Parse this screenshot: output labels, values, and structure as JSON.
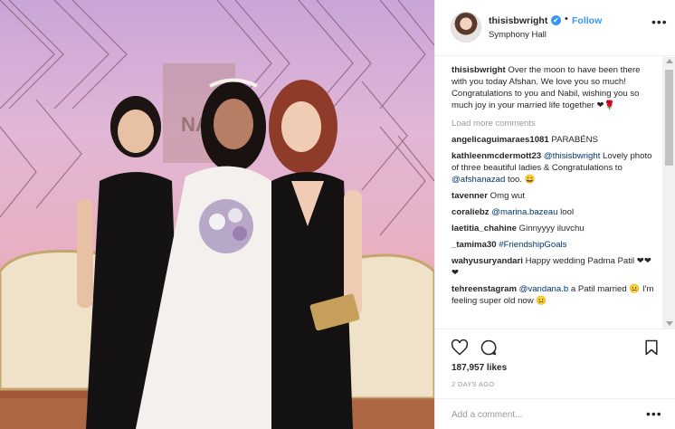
{
  "post": {
    "username": "thisisbwright",
    "verified_mark": "✔",
    "follow_label": "Follow",
    "location": "Symphony Hall",
    "more_options": "•••"
  },
  "photo": {
    "sign_text": "NA",
    "description_icon": "photo-three-women-wedding"
  },
  "caption": {
    "username": "thisisbwright",
    "text": "Over the moon to have been there with you today Afshan. We love you so much! Congratulations to you and Nabil, wishing you so much joy in your married life together ❤🌹"
  },
  "load_more": "Load more comments",
  "comments": [
    {
      "user": "angelicaguimaraes1081",
      "pre": "PARABÉNS",
      "tag": "",
      "post": ""
    },
    {
      "user": "kathleenmcdermott23",
      "pre": "",
      "tag": "@thisisbwright",
      "post": " Lovely photo of three beautiful ladies & Congratulations to ",
      "tag2": "@afshanazad",
      "post2": " too. 😀"
    },
    {
      "user": "tavenner",
      "pre": "Omg wut",
      "tag": "",
      "post": ""
    },
    {
      "user": "coraliebz",
      "pre": "",
      "tag": "@marina.bazeau",
      "post": " lool"
    },
    {
      "user": "laetitia_chahine",
      "pre": "Ginnyyyy iluvchu",
      "tag": "",
      "post": ""
    },
    {
      "user": "_tamima30",
      "pre": "",
      "tag": "#FriendshipGoals",
      "post": ""
    },
    {
      "user": "wahyusuryandari",
      "pre": "Happy wedding Padma Patil ❤❤❤",
      "tag": "",
      "post": ""
    },
    {
      "user": "tehreenstagram",
      "pre": "",
      "tag": "@vandana.b",
      "post": " a Patil married 😐 I'm feeling super old now 😐"
    }
  ],
  "likes": "187,957 likes",
  "timestamp": "2 DAYS AGO",
  "add_comment": {
    "placeholder": "Add a comment...",
    "more_options": "•••"
  },
  "colors": {
    "link": "#3897f0",
    "hashtag": "#003569",
    "muted": "#999999"
  }
}
